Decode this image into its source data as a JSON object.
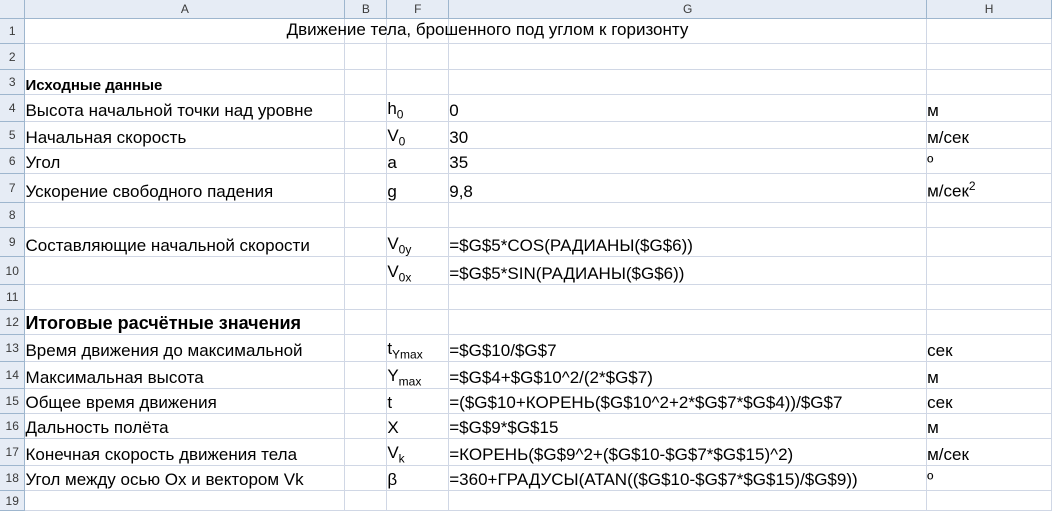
{
  "columns": [
    "A",
    "B",
    "F",
    "G",
    "H"
  ],
  "rows": [
    "1",
    "2",
    "3",
    "4",
    "5",
    "6",
    "7",
    "8",
    "9",
    "10",
    "11",
    "12",
    "13",
    "14",
    "15",
    "16",
    "17",
    "18",
    "19"
  ],
  "title": "Движение тела, брошенного под углом к горизонту",
  "section_input": "Исходные данные",
  "section_results": "Итоговые расчётные значения",
  "inputs": [
    {
      "label": "Высота начальной точки над уровне",
      "sym": "h",
      "sub": "0",
      "value": "0",
      "unit": "м"
    },
    {
      "label": "Начальная скорость",
      "sym": "V",
      "sub": "0",
      "value": "30",
      "unit": "м/сек"
    },
    {
      "label": "Угол",
      "sym": "a",
      "sub": "",
      "value": "35",
      "unit": "º"
    },
    {
      "label": "Ускорение свободного падения",
      "sym": "g",
      "sub": "",
      "value": "9,8",
      "unit": "м/сек",
      "unit_sup": "2"
    }
  ],
  "components": [
    {
      "label": "Составляющие начальной скорости",
      "sym": "V",
      "sub": "0y",
      "value": "=$G$5*COS(РАДИАНЫ($G$6))"
    },
    {
      "label": "",
      "sym": "V",
      "sub": "0x",
      "value": "=$G$5*SIN(РАДИАНЫ($G$6))"
    }
  ],
  "results": [
    {
      "label": "Время движения до максимальной",
      "sym": "t",
      "sub": "Ymax",
      "value": "=$G$10/$G$7",
      "unit": "сек"
    },
    {
      "label": "Максимальная высота",
      "sym": "Y",
      "sub": "max",
      "value": "=$G$4+$G$10^2/(2*$G$7)",
      "unit": "м"
    },
    {
      "label": "Общее время движения",
      "sym": "t",
      "sub": "",
      "value": "=($G$10+КОРЕНЬ($G$10^2+2*$G$7*$G$4))/$G$7",
      "unit": "сек"
    },
    {
      "label": "Дальность полёта",
      "sym": "X",
      "sub": "",
      "value": "=$G$9*$G$15",
      "unit": "м"
    },
    {
      "label": "Конечная скорость движения тела",
      "sym": "V",
      "sub": "k",
      "value": "=КОРЕНЬ($G$9^2+($G$10-$G$7*$G$15)^2)",
      "unit": "м/сек"
    },
    {
      "label": "Угол между осью Ox и вектором Vk",
      "sym": "β",
      "sub": "",
      "value": "=360+ГРАДУСЫ(ATAN(($G$10-$G$7*$G$15)/$G$9))",
      "unit": "º"
    }
  ]
}
